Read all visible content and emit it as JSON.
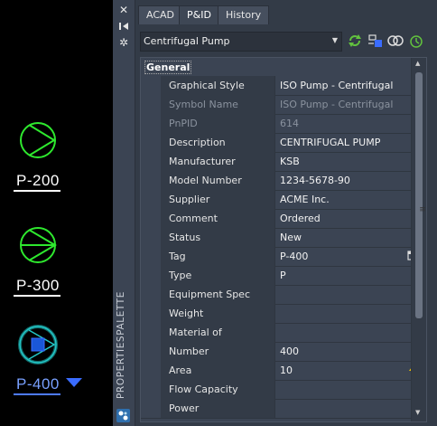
{
  "canvas": {
    "pumps": [
      {
        "tag": "P-200",
        "selected": false
      },
      {
        "tag": "P-300",
        "selected": false
      },
      {
        "tag": "P-400",
        "selected": true
      }
    ],
    "colors": {
      "symbol": "#2ee82e",
      "selected_symbol": "#23c7c7",
      "selected_fill": "#1a57d8",
      "grip": "#3a6cff"
    }
  },
  "palette": {
    "title": "PROPERTIESPALETTE",
    "side_icons": [
      "close-icon",
      "auto-hide-icon",
      "settings-icon"
    ],
    "tabs": [
      {
        "label": "ACAD",
        "active": false
      },
      {
        "label": "P&ID",
        "active": true
      },
      {
        "label": "History",
        "active": false
      }
    ],
    "selector": {
      "value": "Centrifugal Pump"
    },
    "toolbar_icons": [
      "refresh-icon",
      "select-objects-icon",
      "link-icon",
      "timer-icon"
    ],
    "section": "General",
    "properties": [
      {
        "label": "Graphical Style",
        "value": "ISO Pump - Centrifugal",
        "dropdown": true
      },
      {
        "label": "Symbol Name",
        "value": "ISO Pump - Centrifugal",
        "disabled": true
      },
      {
        "label": "PnPID",
        "value": "614",
        "disabled": true
      },
      {
        "label": "Description",
        "value": "CENTRIFUGAL PUMP"
      },
      {
        "label": "Manufacturer",
        "value": "KSB"
      },
      {
        "label": "Model Number",
        "value": "1234-5678-90"
      },
      {
        "label": "Supplier",
        "value": "ACME Inc."
      },
      {
        "label": "Comment",
        "value": "Ordered"
      },
      {
        "label": "Status",
        "value": "New",
        "dropdown": true
      },
      {
        "label": "Tag",
        "value": "P-400",
        "icon": "tag-editor-icon"
      },
      {
        "label": "Type",
        "value": "P",
        "dropdown": true
      },
      {
        "label": "Equipment Spec",
        "value": ""
      },
      {
        "label": "Weight",
        "value": ""
      },
      {
        "label": "Material of Construction",
        "value": ""
      },
      {
        "label": "Number",
        "value": "400"
      },
      {
        "label": "Area",
        "value": "10",
        "icon": "lightning-icon"
      },
      {
        "label": "Flow Capacity",
        "value": ""
      },
      {
        "label": "Power",
        "value": ""
      }
    ]
  }
}
